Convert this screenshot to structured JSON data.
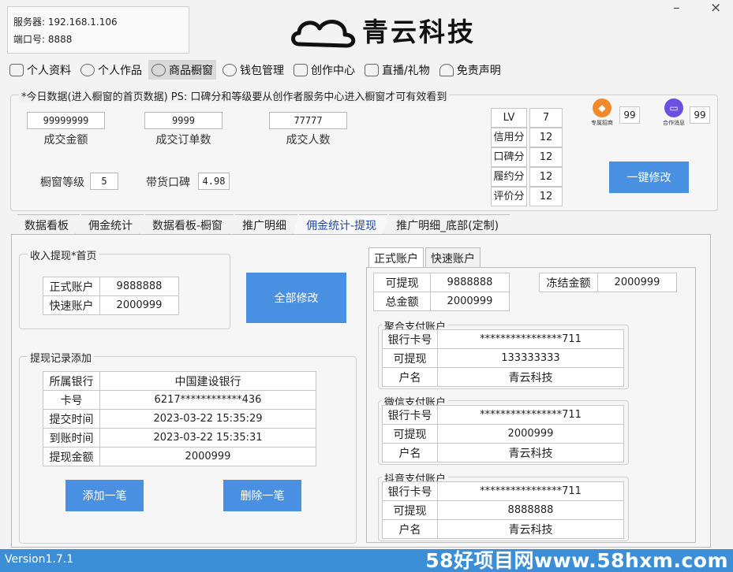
{
  "server": {
    "line1": "服务器: 192.168.1.106",
    "line2": "端口号: 8888"
  },
  "brand": {
    "name": "青云科技"
  },
  "window": {
    "minimize": "–",
    "close": "×"
  },
  "nav": [
    {
      "label": "个人资料",
      "icon": "profile-icon"
    },
    {
      "label": "个人作品",
      "icon": "works-icon"
    },
    {
      "label": "商品橱窗",
      "icon": "showcase-icon"
    },
    {
      "label": "钱包管理",
      "icon": "wallet-icon"
    },
    {
      "label": "创作中心",
      "icon": "create-icon"
    },
    {
      "label": "直播/礼物",
      "icon": "live-icon"
    },
    {
      "label": "免责声明",
      "icon": "disclaimer-icon"
    }
  ],
  "today": {
    "title": "*今日数据(进入橱窗的首页数据) PS: 口碑分和等级要从创作者服务中心进入橱窗才可有效看到",
    "stats": [
      {
        "value": "99999999",
        "label": "成交金额"
      },
      {
        "value": "9999",
        "label": "成交订单数"
      },
      {
        "value": "77777",
        "label": "成交人数"
      }
    ],
    "level_label": "橱窗等级",
    "level_value": "5",
    "rating_label": "带货口碑",
    "rating_value": "4.98",
    "scores": [
      {
        "label": "LV",
        "value": "7"
      },
      {
        "label": "信用分",
        "value": "12"
      },
      {
        "label": "口碑分",
        "value": "12"
      },
      {
        "label": "履约分",
        "value": "12"
      },
      {
        "label": "评价分",
        "value": "12"
      }
    ],
    "icon1": {
      "label": "专属招商",
      "value": "99"
    },
    "icon2": {
      "label": "合作消息",
      "value": "99"
    },
    "edit_button": "一键修改"
  },
  "tabs": [
    "数据看板",
    "佣金统计",
    "数据看板-橱窗",
    "推广明细",
    "佣金统计-提现",
    "推广明细_底部(定制)"
  ],
  "income": {
    "title": "收入提现*首页",
    "rows": [
      {
        "k": "正式账户",
        "v": "9888888"
      },
      {
        "k": "快速账户",
        "v": "2000999"
      }
    ],
    "button": "全部修改"
  },
  "record": {
    "title": "提现记录添加",
    "rows": [
      {
        "k": "所属银行",
        "v": "中国建设银行"
      },
      {
        "k": "卡号",
        "v": "6217************436"
      },
      {
        "k": "提交时间",
        "v": "2023-03-22 15:35:29"
      },
      {
        "k": "到账时间",
        "v": "2023-03-22 15:35:31"
      },
      {
        "k": "提现金额",
        "v": "2000999"
      }
    ],
    "add_button": "添加一笔",
    "delete_button": "删除一笔"
  },
  "account": {
    "tabs": [
      "正式账户",
      "快速账户"
    ],
    "withdrawable_label": "可提现",
    "withdrawable": "9888888",
    "total_label": "总金额",
    "total": "2000999",
    "frozen_label": "冻结金额",
    "frozen": "2000999",
    "groups": [
      {
        "title": "聚合支付账户",
        "card_label": "银行卡号",
        "card": "****************711",
        "avail_label": "可提现",
        "avail": "133333333",
        "name_label": "户名",
        "name": "青云科技"
      },
      {
        "title": "微信支付账户",
        "card_label": "银行卡号",
        "card": "****************711",
        "avail_label": "可提现",
        "avail": "2000999",
        "name_label": "户名",
        "name": "青云科技"
      },
      {
        "title": "抖音支付账户",
        "card_label": "银行卡号",
        "card": "****************711",
        "avail_label": "可提现",
        "avail": "8888888",
        "name_label": "户名",
        "name": "青云科技"
      }
    ]
  },
  "footer": {
    "version": "Version1.7.1",
    "watermark": "58好项目网www.58hxm.com"
  },
  "colors": {
    "accent": "#4a90e2",
    "statusbar": "#3c8fd6",
    "active_tab": "#1f4aa8"
  }
}
